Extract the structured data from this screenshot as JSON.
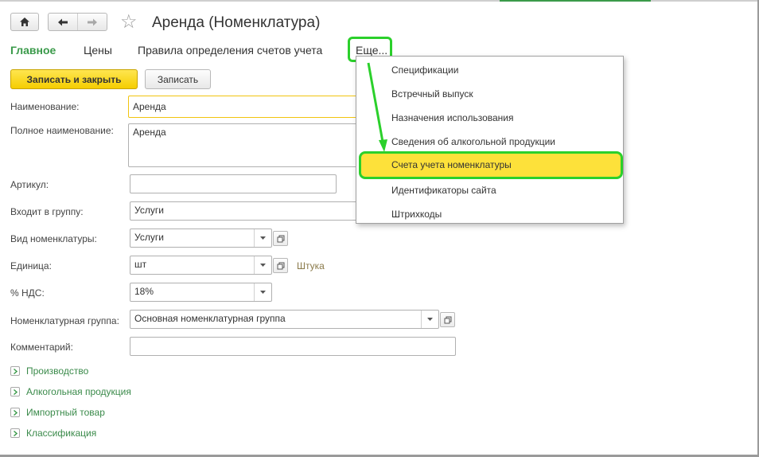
{
  "window": {
    "title": "Аренда (Номенклатура)",
    "accent_color": "#3a9a4a"
  },
  "toolbar": {
    "home_icon": "home-icon",
    "back_icon": "arrow-left-icon",
    "forward_icon": "arrow-right-icon",
    "favorite_icon": "star-icon"
  },
  "tabs": [
    {
      "label": "Главное",
      "active": true
    },
    {
      "label": "Цены",
      "active": false
    },
    {
      "label": "Правила определения счетов учета",
      "active": false
    }
  ],
  "more_label": "Еще...",
  "actions": {
    "save_close": "Записать и закрыть",
    "save": "Записать"
  },
  "form": {
    "name": {
      "label": "Наименование:",
      "value": "Аренда"
    },
    "full_name": {
      "label": "Полное наименование:",
      "value": "Аренда"
    },
    "article": {
      "label": "Артикул:",
      "value": ""
    },
    "group": {
      "label": "Входит в группу:",
      "value": "Услуги"
    },
    "kind": {
      "label": "Вид номенклатуры:",
      "value": "Услуги"
    },
    "unit": {
      "label": "Единица:",
      "value": "шт",
      "hint": "Штука"
    },
    "vat": {
      "label": "% НДС:",
      "value": "18%"
    },
    "nom_group": {
      "label": "Номенклатурная группа:",
      "value": "Основная номенклатурная группа"
    },
    "comment": {
      "label": "Комментарий:",
      "value": ""
    }
  },
  "groups": [
    {
      "label": "Производство"
    },
    {
      "label": "Алкогольная продукция"
    },
    {
      "label": "Импортный товар"
    },
    {
      "label": "Классификация"
    }
  ],
  "menu": {
    "items": [
      {
        "label": "Спецификации"
      },
      {
        "label": "Встречный выпуск"
      },
      {
        "label": "Назначения использования"
      },
      {
        "label": "Сведения об алкогольной продукции"
      },
      {
        "label": "Счета учета номенклатуры",
        "highlighted": true
      },
      {
        "label": "Идентификаторы сайта"
      },
      {
        "label": "Штрихкоды"
      }
    ]
  },
  "colors": {
    "highlight_border": "#2bd02b",
    "highlight_fill": "#fde13a",
    "primary_button": "#f5cd00",
    "focus_border": "#f1c40f"
  }
}
